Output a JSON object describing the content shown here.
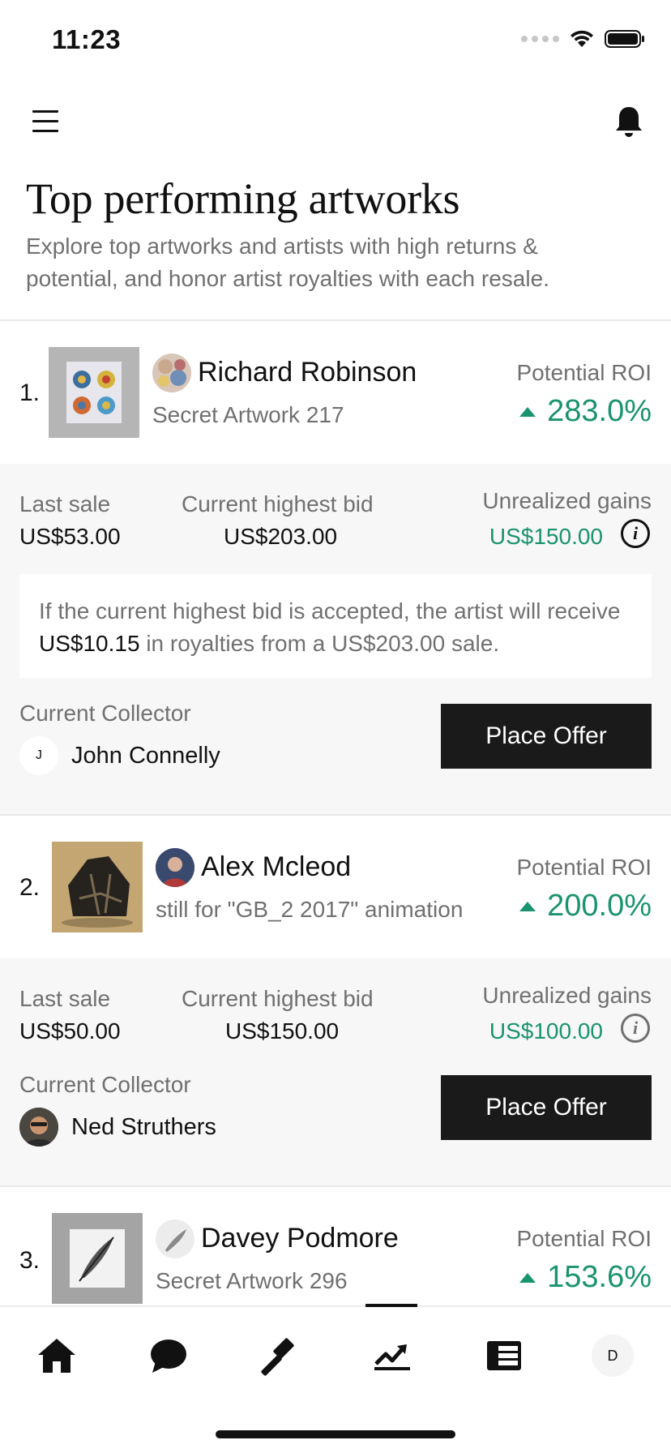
{
  "status_bar": {
    "time": "11:23"
  },
  "header": {
    "title": "Top performing artworks",
    "subtitle": "Explore top artworks and artists with high returns & potential, and honor artist royalties with each resale."
  },
  "labels": {
    "potential_roi": "Potential ROI",
    "last_sale": "Last sale",
    "current_highest_bid": "Current highest bid",
    "unrealized_gains": "Unrealized gains",
    "current_collector": "Current Collector",
    "place_offer": "Place Offer"
  },
  "artworks": [
    {
      "rank": "1.",
      "artist": "Richard Robinson",
      "title": "Secret Artwork 217",
      "roi": "283.0%",
      "last_sale": "US$53.00",
      "highest_bid": "US$203.00",
      "unrealized_gains": "US$150.00",
      "royalty_text_before": "If the current highest bid is accepted, the artist will receive ",
      "royalty_amount": "US$10.15",
      "royalty_text_after": " in royalties from a US$203.00 sale.",
      "collector": "John Connelly",
      "collector_avatar_initial": "J"
    },
    {
      "rank": "2.",
      "artist": "Alex Mcleod",
      "title": "still for \"GB_2 2017\" animation",
      "roi": "200.0%",
      "last_sale": "US$50.00",
      "highest_bid": "US$150.00",
      "unrealized_gains": "US$100.00",
      "collector": "Ned Struthers"
    },
    {
      "rank": "3.",
      "artist": "Davey Podmore",
      "title": "Secret Artwork 296",
      "roi": "153.6%"
    }
  ],
  "tab_bar": {
    "items": [
      "home-icon",
      "chat-icon",
      "auction-gavel-icon",
      "trending-icon",
      "list-icon"
    ],
    "active": "trending-icon",
    "profile_initial": "D"
  },
  "colors": {
    "accent_green": "#1a936f",
    "button_dark": "#1a1a1a",
    "detail_bg": "#f7f7f7"
  }
}
